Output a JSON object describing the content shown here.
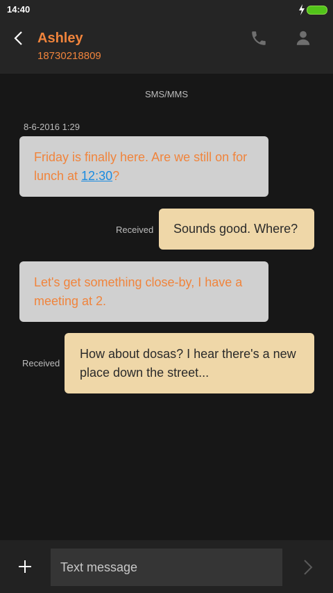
{
  "status_bar": {
    "time": "14:40"
  },
  "header": {
    "contact_name": "Ashley",
    "phone_number": "18730218809",
    "accent_color": "#f0843c"
  },
  "conversation": {
    "channel_label": "SMS/MMS",
    "timestamp": "8-6-2016 1:29",
    "messages": [
      {
        "direction": "incoming",
        "text_before_link": "Friday is finally here. Are we still on for lunch at ",
        "link_text": "12:30",
        "text_after_link": "?"
      },
      {
        "direction": "outgoing",
        "status": "Received",
        "text": "Sounds good. Where?"
      },
      {
        "direction": "incoming",
        "text": "Let's get something close-by, I have a meeting at 2."
      },
      {
        "direction": "outgoing",
        "status": "Received",
        "text": "How about dosas? I hear there's a new place down the street..."
      }
    ]
  },
  "composer": {
    "placeholder": "Text message",
    "icons": {
      "add": "plus-icon",
      "send": "chevron-right-icon"
    }
  }
}
